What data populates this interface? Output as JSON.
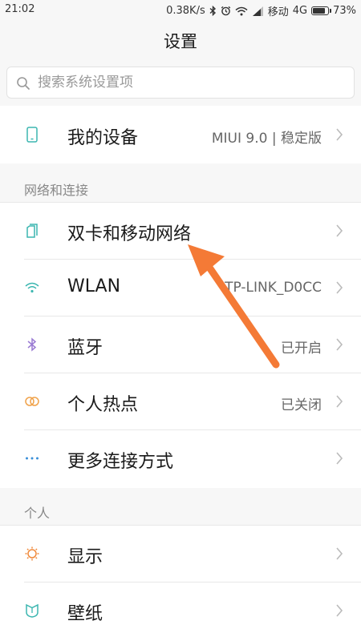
{
  "status_bar": {
    "time": "21:02",
    "speed": "0.38K/s",
    "carrier": "移动",
    "network": "4G",
    "battery": "73%",
    "battery_level": 0.73,
    "icons": [
      "bluetooth-icon",
      "alarm-icon",
      "wifi-icon",
      "signal-icon",
      "battery-icon"
    ]
  },
  "header": {
    "title": "设置"
  },
  "search": {
    "placeholder": "搜索系统设置项",
    "icon": "search-icon"
  },
  "device": {
    "label": "我的设备",
    "value": "MIUI 9.0 | 稳定版",
    "icon": "phone-icon"
  },
  "network": {
    "header": "网络和连接",
    "items": [
      {
        "label": "双卡和移动网络",
        "value": "",
        "icon": "sim-card-icon"
      },
      {
        "label": "WLAN",
        "value": "TP-LINK_D0CC",
        "icon": "wifi-icon"
      },
      {
        "label": "蓝牙",
        "value": "已开启",
        "icon": "bluetooth-icon"
      },
      {
        "label": "个人热点",
        "value": "已关闭",
        "icon": "hotspot-icon"
      },
      {
        "label": "更多连接方式",
        "value": "",
        "icon": "more-dots-icon"
      }
    ]
  },
  "personal": {
    "header": "个人",
    "items": [
      {
        "label": "显示",
        "value": "",
        "icon": "brightness-icon"
      },
      {
        "label": "壁纸",
        "value": "",
        "icon": "wallpaper-icon"
      }
    ]
  },
  "colors": {
    "accent_teal": "#3bb6b0",
    "bluetooth_purple": "#9a7bd3",
    "hotspot_orange": "#f0a24a",
    "display_orange": "#f08a3c",
    "annotation_arrow": "#f47a36"
  }
}
